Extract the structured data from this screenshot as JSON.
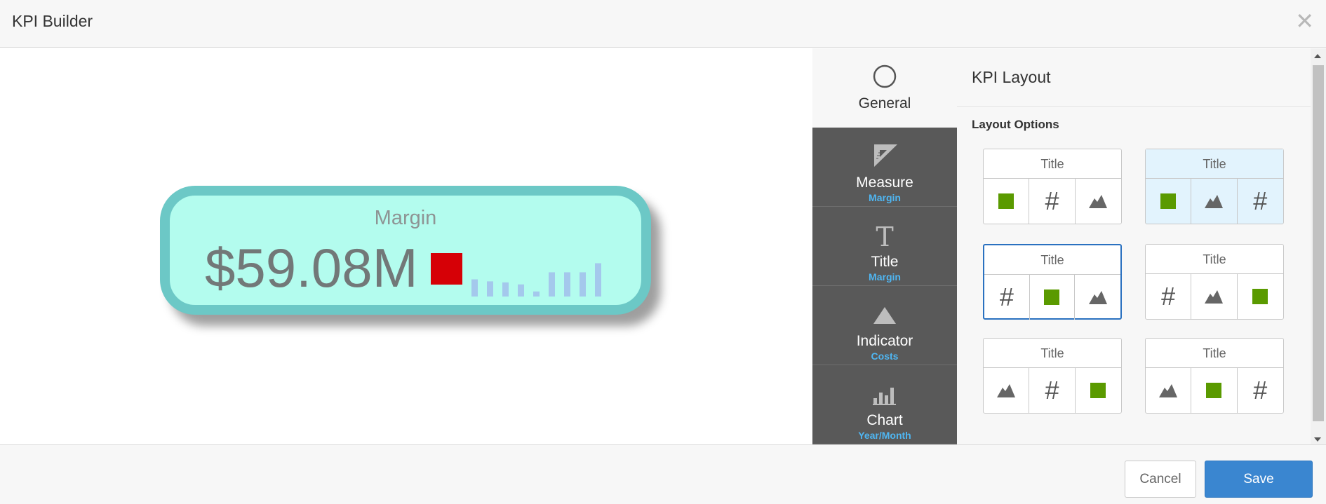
{
  "window": {
    "title": "KPI Builder",
    "close_glyph": "✕"
  },
  "kpi": {
    "title": "Margin",
    "value": "$59.08M",
    "indicator_color": "#d60006",
    "sparkline": {
      "values": [
        0.34,
        0.3,
        0.28,
        0.24,
        0.1,
        0.48,
        0.48,
        0.48,
        0.66
      ]
    }
  },
  "tabs": [
    {
      "label": "General",
      "sub": "",
      "icon": "circle-icon",
      "active": true
    },
    {
      "label": "Measure",
      "sub": "Margin",
      "icon": "ruler-triangle-icon"
    },
    {
      "label": "Title",
      "sub": "Margin",
      "icon": "title-t-icon"
    },
    {
      "label": "Indicator",
      "sub": "Costs",
      "icon": "triangle-icon"
    },
    {
      "label": "Chart",
      "sub": "Year/Month",
      "icon": "bar-chart-icon"
    }
  ],
  "panel": {
    "title": "KPI Layout",
    "section_label": "Layout Options",
    "options": [
      {
        "title": "Title",
        "cells": [
          "indicator",
          "value",
          "chart"
        ],
        "state": ""
      },
      {
        "title": "Title",
        "cells": [
          "indicator",
          "chart",
          "value"
        ],
        "state": "highlighted"
      },
      {
        "title": "Title",
        "cells": [
          "value",
          "indicator",
          "chart"
        ],
        "state": "selected"
      },
      {
        "title": "Title",
        "cells": [
          "value",
          "chart",
          "indicator"
        ],
        "state": ""
      },
      {
        "title": "Title",
        "cells": [
          "chart",
          "value",
          "indicator"
        ],
        "state": ""
      },
      {
        "title": "Title",
        "cells": [
          "chart",
          "indicator",
          "value"
        ],
        "state": ""
      }
    ]
  },
  "footer": {
    "cancel_label": "Cancel",
    "save_label": "Save"
  },
  "colors": {
    "accent": "#3a86d0",
    "indicator_green": "#5a9a00",
    "tab_sub": "#4fb6f2",
    "card_fill": "#b3fcee",
    "card_border": "#6cc8c6"
  }
}
